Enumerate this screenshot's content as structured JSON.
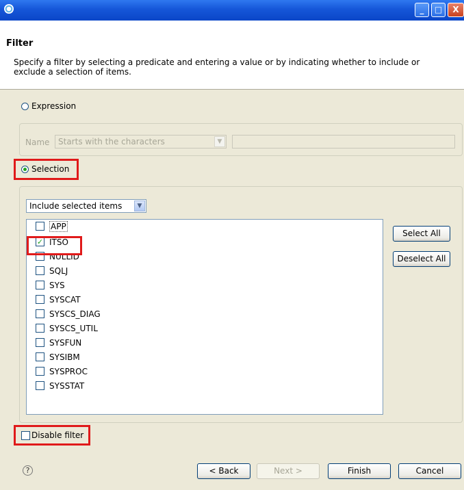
{
  "window": {
    "app_icon": "eclipse-icon",
    "controls": {
      "minimize": "_",
      "maximize": "□",
      "close": "X"
    }
  },
  "header": {
    "title": "Filter",
    "description": "Specify a filter by selecting a predicate and entering a value or by indicating whether to include or exclude a selection of items."
  },
  "expression": {
    "label": "Expression",
    "selected": false,
    "name_label": "Name",
    "predicate_value": "Starts with the characters",
    "value_text": ""
  },
  "selection": {
    "label": "Selection",
    "selected": true,
    "mode_value": "Include selected items",
    "items": [
      {
        "label": "APP",
        "checked": false
      },
      {
        "label": "ITSO",
        "checked": true
      },
      {
        "label": "NULLID",
        "checked": false
      },
      {
        "label": "SQLJ",
        "checked": false
      },
      {
        "label": "SYS",
        "checked": false
      },
      {
        "label": "SYSCAT",
        "checked": false
      },
      {
        "label": "SYSCS_DIAG",
        "checked": false
      },
      {
        "label": "SYSCS_UTIL",
        "checked": false
      },
      {
        "label": "SYSFUN",
        "checked": false
      },
      {
        "label": "SYSIBM",
        "checked": false
      },
      {
        "label": "SYSPROC",
        "checked": false
      },
      {
        "label": "SYSSTAT",
        "checked": false
      }
    ],
    "select_all": "Select All",
    "deselect_all": "Deselect All"
  },
  "disable_filter": {
    "label": "Disable filter",
    "checked": false
  },
  "footer": {
    "help": "?",
    "back": "< Back",
    "next": "Next >",
    "finish": "Finish",
    "cancel": "Cancel"
  },
  "colors": {
    "titlebar": "#1556d8",
    "dialog_bg": "#ece9d8",
    "highlight": "#e01a1a",
    "check": "#21a121"
  }
}
